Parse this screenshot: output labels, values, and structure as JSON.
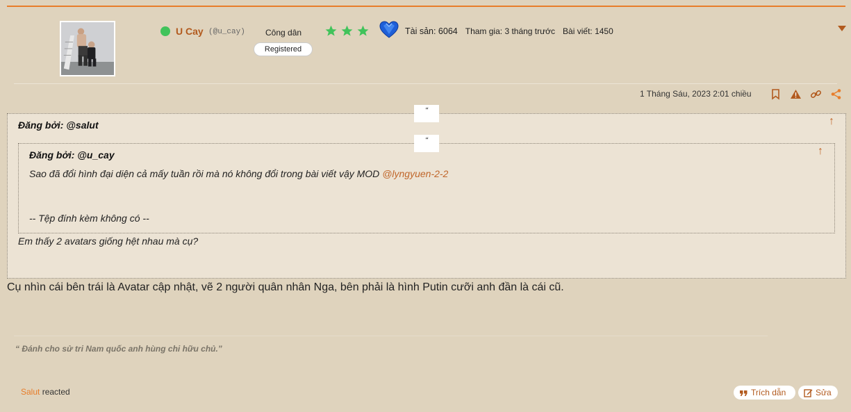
{
  "author": {
    "username": "U Cay",
    "handle": "(@u_cay)",
    "rank": "Công dân",
    "badge": "Registered",
    "online_icon": "online-status-dot",
    "stars": [
      "star-icon",
      "star-icon",
      "star-icon"
    ],
    "gem_icon": "blue-heart-gem-icon",
    "stats": {
      "assets": "Tài sản: 6064",
      "joined": "Tham gia: 3 tháng trước",
      "posts": "Bài viết: 1450"
    }
  },
  "post": {
    "date": "1 Tháng Sáu, 2023 2:01 chiều",
    "actions": [
      "bookmark-icon",
      "warning-icon",
      "link-icon",
      "share-icon"
    ],
    "outer_quote": {
      "mark": "“",
      "by": "Đăng bởi: @salut",
      "text": "Em thấy 2 avatars giống hệt nhau mà cụ?"
    },
    "inner_quote": {
      "mark": "“",
      "by": "Đăng bởi: @u_cay",
      "text": "Sao đã đổi hình đại diện cả mấy tuần rồi mà nó không đổi trong bài viết vậy MOD ",
      "mention": "@lyngyuen-2-2",
      "attachment_note": "-- Tệp đính kèm không có --"
    },
    "up_arrow": "↑",
    "body": "Cụ nhìn cái bên trái là Avatar cập nhật,  vẽ 2 người quân nhân Nga, bên phải là hình Putin cưỡi anh đần là cái cũ.",
    "signature": "“ Đánh cho sử tri Nam quốc anh hùng chi hữu chủ.”",
    "reactions": {
      "who": "Salut",
      "label": " reacted"
    },
    "buttons": {
      "quote": "Trích dẫn",
      "edit": "Sửa"
    }
  },
  "colors": {
    "accent": "#e87d2a",
    "link": "#b25a1e",
    "background": "#dfd3bd",
    "quote_background": "#ece3d4",
    "online": "#41c35b",
    "star": "#41c35b"
  }
}
